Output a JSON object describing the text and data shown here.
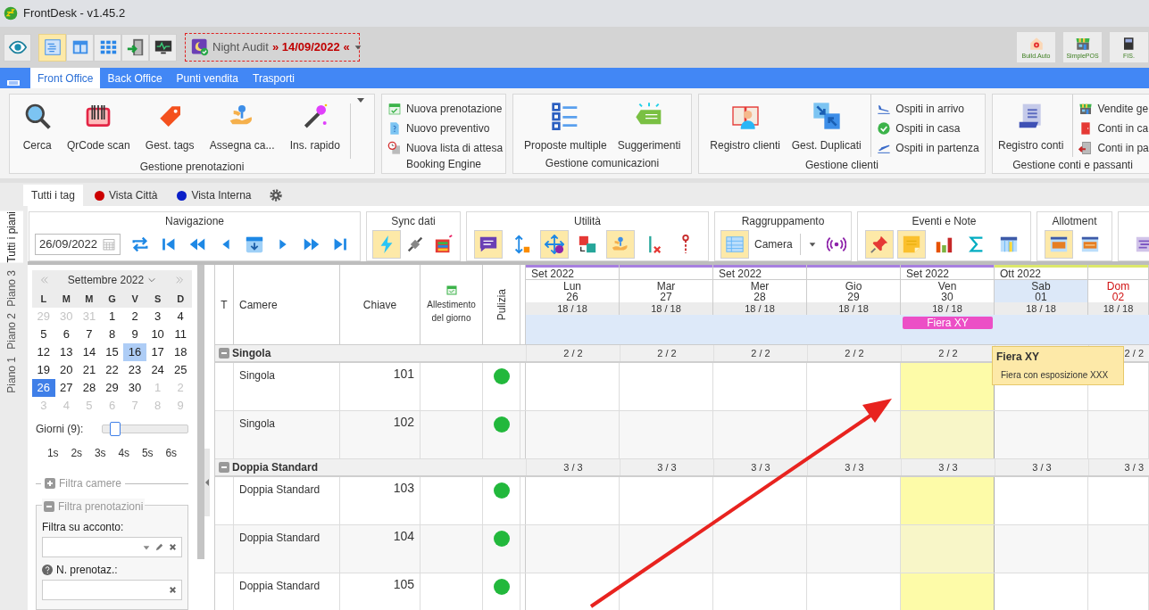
{
  "window": {
    "title": "FrontDesk - v1.45.2"
  },
  "toolbar": {
    "buttons": [
      {
        "selected": false
      },
      {
        "selected": true
      },
      {
        "selected": false
      },
      {
        "selected": false
      },
      {
        "selected": false
      },
      {
        "selected": false
      }
    ],
    "night_audit": {
      "label": "Night Audit",
      "date": "» 14/09/2022 «"
    },
    "apps": [
      {
        "label": "Build.Auto"
      },
      {
        "label": "SimplePOS"
      },
      {
        "label": "FIS."
      }
    ]
  },
  "ribbon_tabs": [
    {
      "label": "Front Office",
      "selected": true
    },
    {
      "label": "Back Office",
      "selected": false
    },
    {
      "label": "Punti vendita",
      "selected": false
    },
    {
      "label": "Trasporti",
      "selected": false
    }
  ],
  "ribbon_groups": [
    {
      "title": "Gestione prenotazioni",
      "large": [
        "Cerca",
        "QrCode scan",
        "Gest. tags",
        "Assegna ca...",
        "Ins. rapido"
      ]
    },
    {
      "title": "Booking Engine",
      "small": [
        "Nuova prenotazione",
        "Nuovo preventivo",
        "Nuova lista di attesa"
      ]
    },
    {
      "title": "Gestione comunicazioni",
      "large": [
        "Proposte multiple",
        "Suggerimenti"
      ]
    },
    {
      "title": "Gestione clienti",
      "large": [
        "Registro clienti",
        "Gest. Duplicati"
      ],
      "small": [
        "Ospiti in arrivo",
        "Ospiti in casa",
        "Ospiti in partenza"
      ]
    },
    {
      "title": "Gestione conti e passanti",
      "large": [
        "Registro conti"
      ],
      "small": [
        "Vendite ge",
        "Conti in ca",
        "Conti in pa"
      ]
    }
  ],
  "view_tabs": [
    {
      "label": "Tutti i tag",
      "selected": true
    },
    {
      "label": "Vista Città",
      "color": "#cc0000",
      "selected": false
    },
    {
      "label": "Vista Interna",
      "color": "#0a1fc8",
      "selected": false
    }
  ],
  "tool_groups": [
    {
      "title": "Navigazione",
      "date": "26/09/2022",
      "buttons": [
        {
          "selected": false
        },
        {
          "selected": false
        },
        {
          "selected": false
        },
        {
          "selected": false
        },
        {
          "selected": false
        },
        {
          "selected": false
        },
        {
          "selected": false
        },
        {
          "selected": false
        }
      ]
    },
    {
      "title": "Sync dati",
      "buttons": [
        {
          "selected": true
        },
        {
          "selected": false
        },
        {
          "selected": false
        }
      ]
    },
    {
      "title": "Utilità",
      "buttons": [
        {
          "selected": true
        },
        {
          "selected": false
        },
        {
          "selected": true
        },
        {
          "selected": false
        },
        {
          "selected": true
        },
        {
          "selected": false
        },
        {
          "selected": false
        }
      ]
    },
    {
      "title": "Raggruppamento",
      "grouping": "Camera",
      "buttons": [
        {
          "selected": true
        },
        {
          "selected": false
        }
      ]
    },
    {
      "title": "Eventi e Note",
      "buttons": [
        {
          "selected": true
        },
        {
          "selected": true
        },
        {
          "selected": false
        },
        {
          "selected": false
        },
        {
          "selected": false
        }
      ]
    },
    {
      "title": "Allotment",
      "buttons": [
        {
          "selected": true
        },
        {
          "selected": false
        }
      ]
    },
    {
      "buttons": [
        {
          "selected": false
        }
      ]
    }
  ],
  "floor_tabs": [
    {
      "label": "Tutti i piani",
      "selected": true
    },
    {
      "label": "Piano 3",
      "selected": false
    },
    {
      "label": "Piano 2",
      "selected": false
    },
    {
      "label": "Piano 1",
      "selected": false
    }
  ],
  "calendar": {
    "month": "Settembre 2022",
    "weekdays": [
      "L",
      "M",
      "M",
      "G",
      "V",
      "S",
      "D"
    ],
    "days": [
      {
        "label": "29",
        "outside": true,
        "selected": false,
        "highlighted": false
      },
      {
        "label": "30",
        "outside": true,
        "selected": false,
        "highlighted": false
      },
      {
        "label": "31",
        "outside": true,
        "selected": false,
        "highlighted": false
      },
      {
        "label": "1",
        "outside": false,
        "selected": false,
        "highlighted": false
      },
      {
        "label": "2",
        "outside": false,
        "selected": false,
        "highlighted": false
      },
      {
        "label": "3",
        "outside": false,
        "selected": false,
        "highlighted": false
      },
      {
        "label": "4",
        "outside": false,
        "selected": false,
        "highlighted": false
      },
      {
        "label": "5",
        "outside": false,
        "selected": false,
        "highlighted": false
      },
      {
        "label": "6",
        "outside": false,
        "selected": false,
        "highlighted": false
      },
      {
        "label": "7",
        "outside": false,
        "selected": false,
        "highlighted": false
      },
      {
        "label": "8",
        "outside": false,
        "selected": false,
        "highlighted": false
      },
      {
        "label": "9",
        "outside": false,
        "selected": false,
        "highlighted": false
      },
      {
        "label": "10",
        "outside": false,
        "selected": false,
        "highlighted": false
      },
      {
        "label": "11",
        "outside": false,
        "selected": false,
        "highlighted": false
      },
      {
        "label": "12",
        "outside": false,
        "selected": false,
        "highlighted": false
      },
      {
        "label": "13",
        "outside": false,
        "selected": false,
        "highlighted": false
      },
      {
        "label": "14",
        "outside": false,
        "selected": false,
        "highlighted": false
      },
      {
        "label": "15",
        "outside": false,
        "selected": false,
        "highlighted": false
      },
      {
        "label": "16",
        "outside": false,
        "selected": false,
        "highlighted": true
      },
      {
        "label": "17",
        "outside": false,
        "selected": false,
        "highlighted": false
      },
      {
        "label": "18",
        "outside": false,
        "selected": false,
        "highlighted": false
      },
      {
        "label": "19",
        "outside": false,
        "selected": false,
        "highlighted": false
      },
      {
        "label": "20",
        "outside": false,
        "selected": false,
        "highlighted": false
      },
      {
        "label": "21",
        "outside": false,
        "selected": false,
        "highlighted": false
      },
      {
        "label": "22",
        "outside": false,
        "selected": false,
        "highlighted": false
      },
      {
        "label": "23",
        "outside": false,
        "selected": false,
        "highlighted": false
      },
      {
        "label": "24",
        "outside": false,
        "selected": false,
        "highlighted": false
      },
      {
        "label": "25",
        "outside": false,
        "selected": false,
        "highlighted": false
      },
      {
        "label": "26",
        "outside": false,
        "selected": true,
        "highlighted": false
      },
      {
        "label": "27",
        "outside": false,
        "selected": false,
        "highlighted": false
      },
      {
        "label": "28",
        "outside": false,
        "selected": false,
        "highlighted": false
      },
      {
        "label": "29",
        "outside": false,
        "selected": false,
        "highlighted": false
      },
      {
        "label": "30",
        "outside": false,
        "selected": false,
        "highlighted": false
      },
      {
        "label": "1",
        "outside": true,
        "selected": false,
        "highlighted": false
      },
      {
        "label": "2",
        "outside": true,
        "selected": false,
        "highlighted": false
      },
      {
        "label": "3",
        "outside": true,
        "selected": false,
        "highlighted": false
      },
      {
        "label": "4",
        "outside": true,
        "selected": false,
        "highlighted": false
      },
      {
        "label": "5",
        "outside": true,
        "selected": false,
        "highlighted": false
      },
      {
        "label": "6",
        "outside": true,
        "selected": false,
        "highlighted": false
      },
      {
        "label": "7",
        "outside": true,
        "selected": false,
        "highlighted": false
      },
      {
        "label": "8",
        "outside": true,
        "selected": false,
        "highlighted": false
      },
      {
        "label": "9",
        "outside": true,
        "selected": false,
        "highlighted": false
      }
    ]
  },
  "days_slider": {
    "label": "Giorni (9):",
    "level": 0.15
  },
  "week_buttons": [
    "1s",
    "2s",
    "3s",
    "4s",
    "5s",
    "6s"
  ],
  "filters": [
    {
      "label": "Filtra camere",
      "expanded": false
    },
    {
      "label": "Filtra prenotazioni",
      "expanded": true,
      "fields": [
        {
          "label": "Filtra su acconto:",
          "kind": "combo",
          "help": false
        },
        {
          "label": "N. prenotaz.:",
          "kind": "text",
          "help": true
        }
      ]
    }
  ],
  "grid": {
    "columns": [
      "T",
      "Camere",
      "Chiave",
      "Allestimento del giorno",
      "Pulizia"
    ],
    "days": [
      {
        "month": "Set 2022",
        "name": "Lun",
        "date": "26",
        "count": "18 / 18",
        "color": "#a77fe0",
        "kind": "weekday",
        "highlighted": false
      },
      {
        "name": "Mar",
        "date": "27",
        "count": "18 / 18",
        "color": "#a77fe0",
        "kind": "weekday",
        "highlighted": false
      },
      {
        "month": "Set 2022",
        "name": "Mer",
        "date": "28",
        "count": "18 / 18",
        "color": "#a77fe0",
        "kind": "weekday",
        "highlighted": false
      },
      {
        "name": "Gio",
        "date": "29",
        "count": "18 / 18",
        "color": "#a77fe0",
        "kind": "weekday",
        "highlighted": false
      },
      {
        "month": "Set 2022",
        "name": "Ven",
        "date": "30",
        "count": "18 / 18",
        "color": "#a77fe0",
        "kind": "weekday",
        "highlighted": true,
        "events": [
          {
            "label": "Fiera XY",
            "color": "#ec4fc6"
          }
        ]
      },
      {
        "month": "Ott 2022",
        "name": "Sab",
        "date": "01",
        "count": "18 / 18",
        "color": "#dce86a",
        "kind": "saturday",
        "highlighted": false
      },
      {
        "name": "Dom",
        "date": "02",
        "count": "18 / 18",
        "color": "#dce86a",
        "kind": "sunday",
        "highlighted": false
      }
    ],
    "groups": [
      {
        "name": "Singola",
        "expanded": true,
        "counts": [
          "2 / 2",
          "2 / 2",
          "2 / 2",
          "2 / 2",
          "2 / 2",
          "2 / 2"
        ],
        "rooms": [
          {
            "type": "Singola",
            "key": "101",
            "color": "#22b83c"
          },
          {
            "type": "Singola",
            "key": "102",
            "color": "#22b83c"
          }
        ]
      },
      {
        "name": "Doppia Standard",
        "expanded": true,
        "counts": [
          "3 / 3",
          "3 / 3",
          "3 / 3",
          "3 / 3",
          "3 / 3",
          "3 / 3",
          "3 / 3"
        ],
        "rooms": [
          {
            "type": "Doppia Standard",
            "key": "103",
            "color": "#22b83c"
          },
          {
            "type": "Doppia Standard",
            "key": "104",
            "color": "#22b83c"
          },
          {
            "type": "Doppia Standard",
            "key": "105",
            "color": "#22b83c"
          }
        ]
      }
    ]
  },
  "tooltip": {
    "title": "Fiera XY",
    "text": "Fiera con esposizione XXX"
  }
}
